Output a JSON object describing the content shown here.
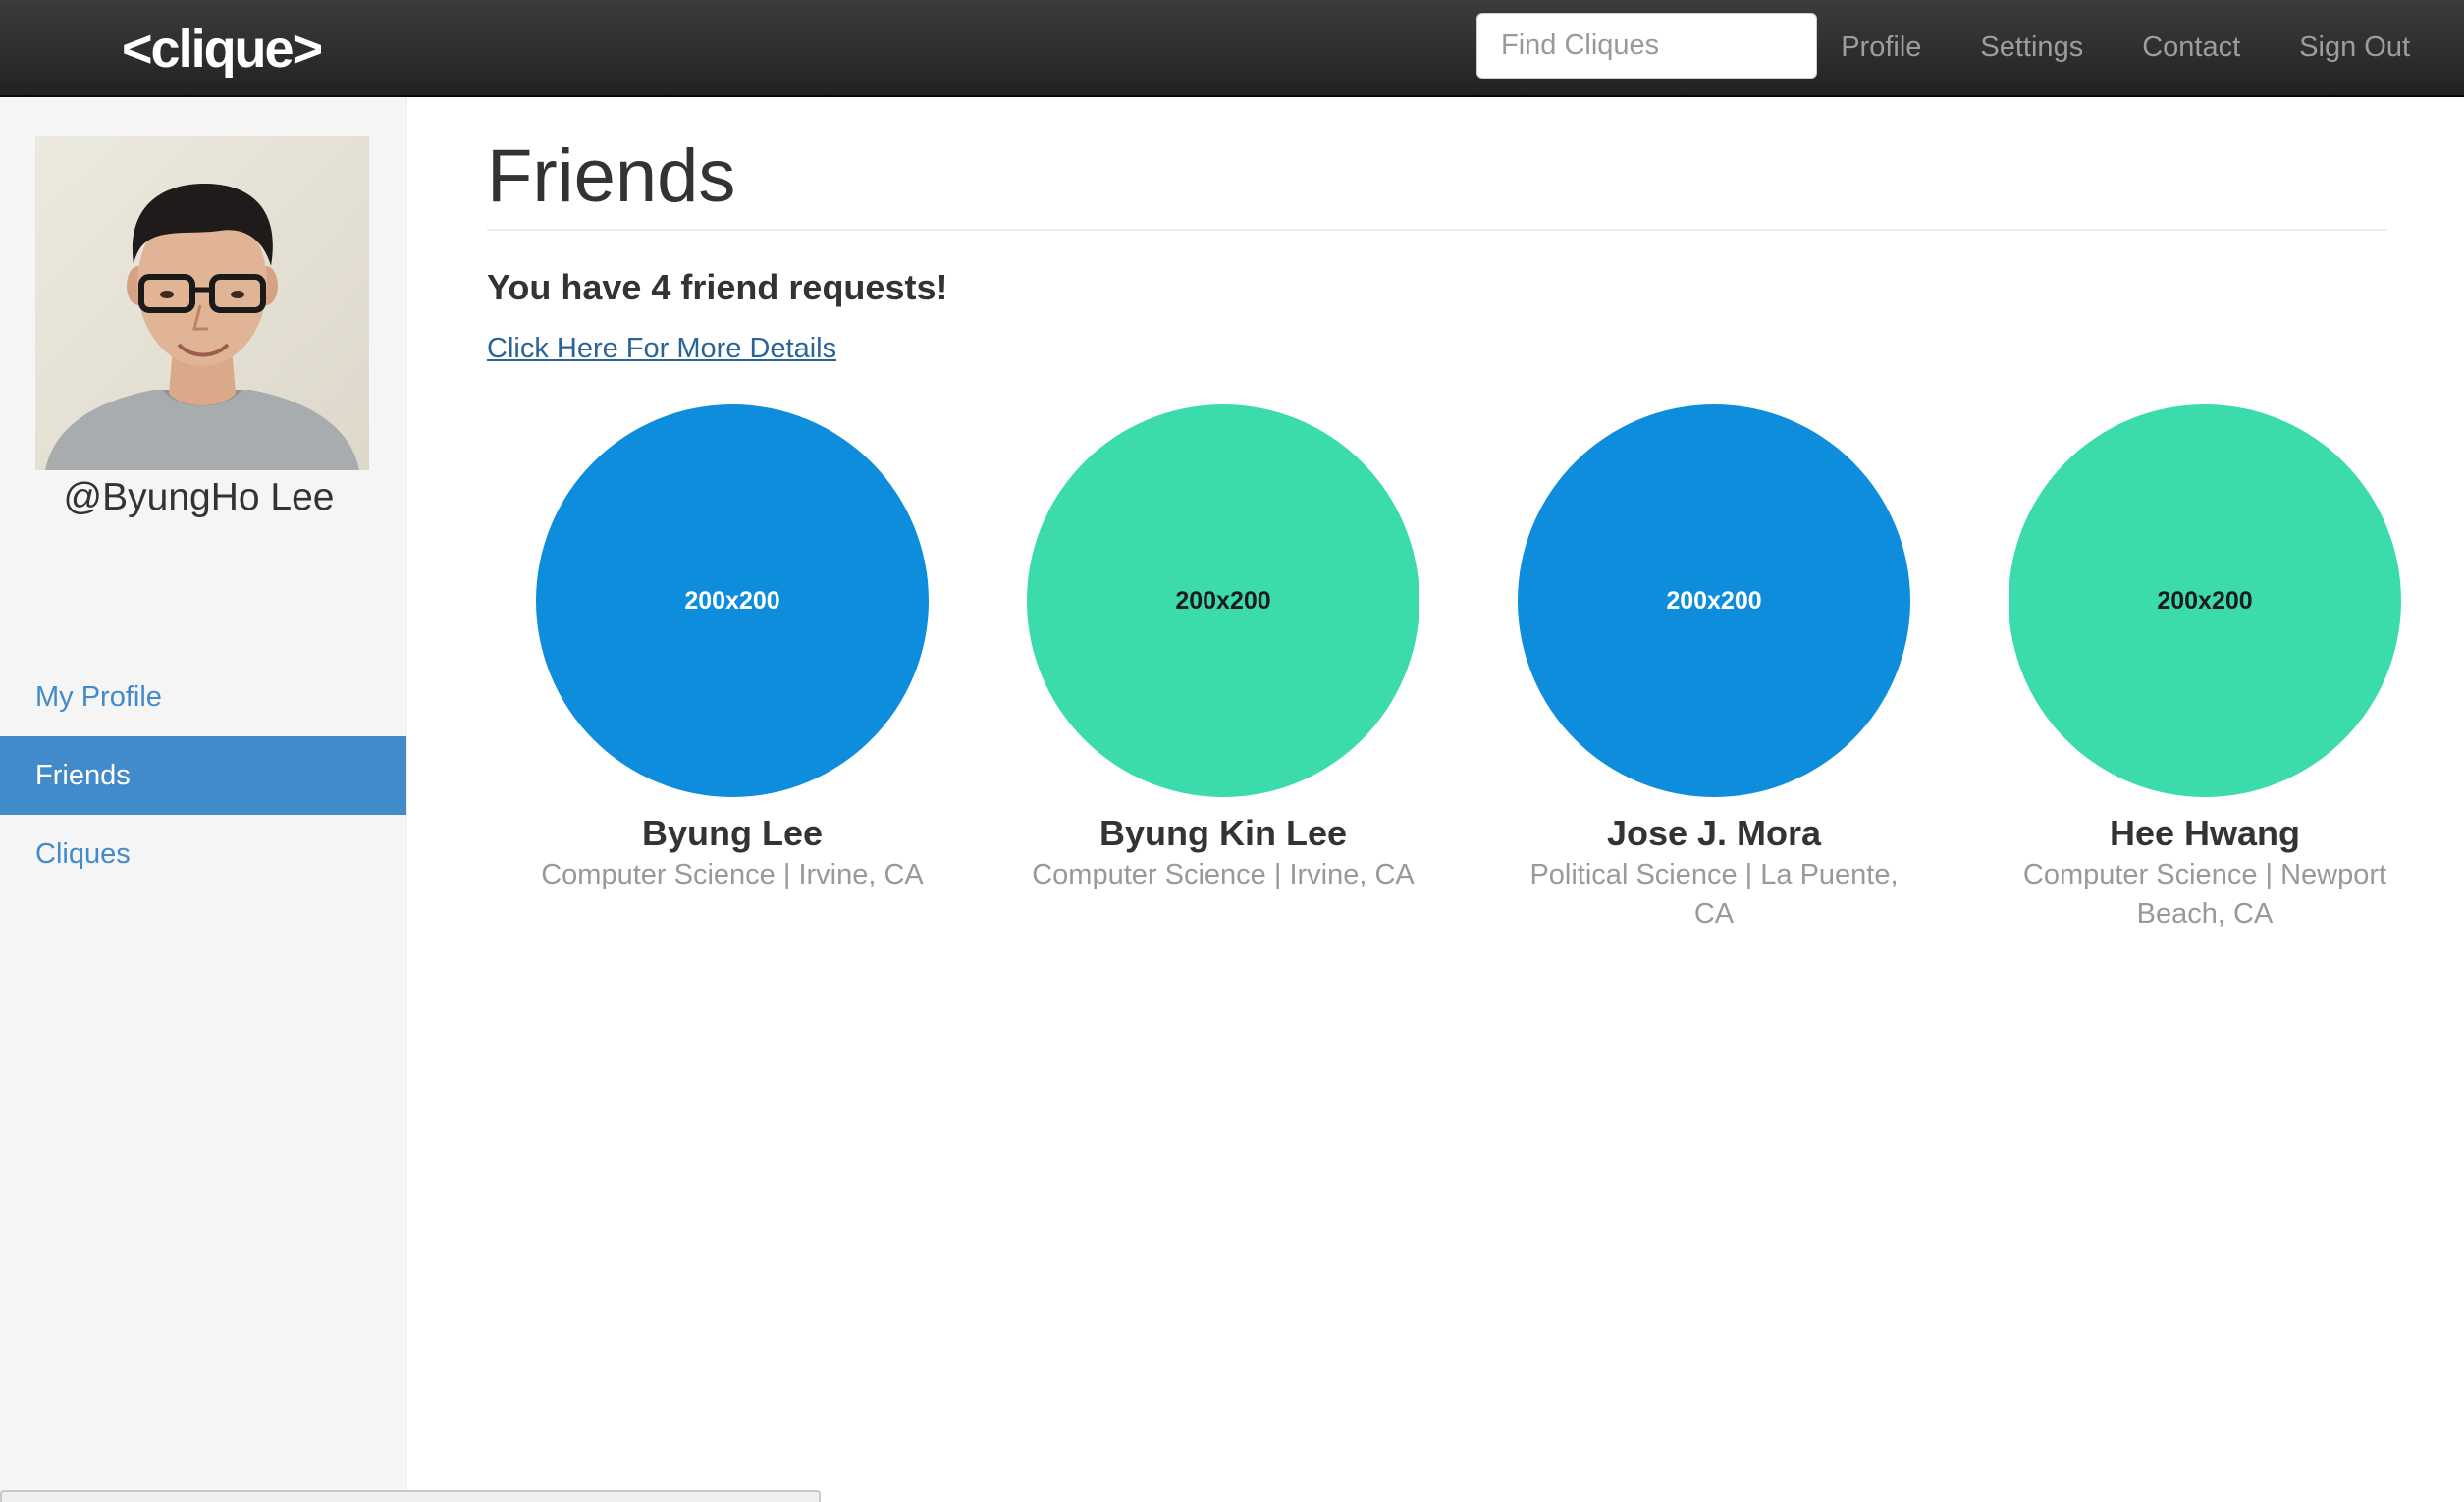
{
  "navbar": {
    "brand": "<clique>",
    "search_placeholder": "Find Cliques",
    "links": {
      "profile": "Profile",
      "settings": "Settings",
      "contact": "Contact",
      "sign_out": "Sign Out"
    },
    "background_color": "#222222"
  },
  "sidebar": {
    "username": "@ByungHo Lee",
    "nav": {
      "my_profile": "My Profile",
      "friends": "Friends",
      "cliques": "Cliques"
    },
    "active_item": "Friends",
    "accent_color": "#428bca"
  },
  "main": {
    "title": "Friends",
    "requests_text": "You have 4 friend requests!",
    "details_link": "Click Here For More Details",
    "friends": [
      {
        "placeholder": "200x200",
        "name": "Byung Lee",
        "info": "Computer Science | Irvine, CA",
        "circle_color": "#0d8ddb"
      },
      {
        "placeholder": "200x200",
        "name": "Byung Kin Lee",
        "info": "Computer Science | Irvine, CA",
        "circle_color": "#3bdbac"
      },
      {
        "placeholder": "200x200",
        "name": "Jose J. Mora",
        "info": "Political Science | La Puente, CA",
        "circle_color": "#0d8ddb"
      },
      {
        "placeholder": "200x200",
        "name": "Hee Hwang",
        "info": "Computer Science | Newport Beach, CA",
        "circle_color": "#3bdbac"
      }
    ]
  }
}
